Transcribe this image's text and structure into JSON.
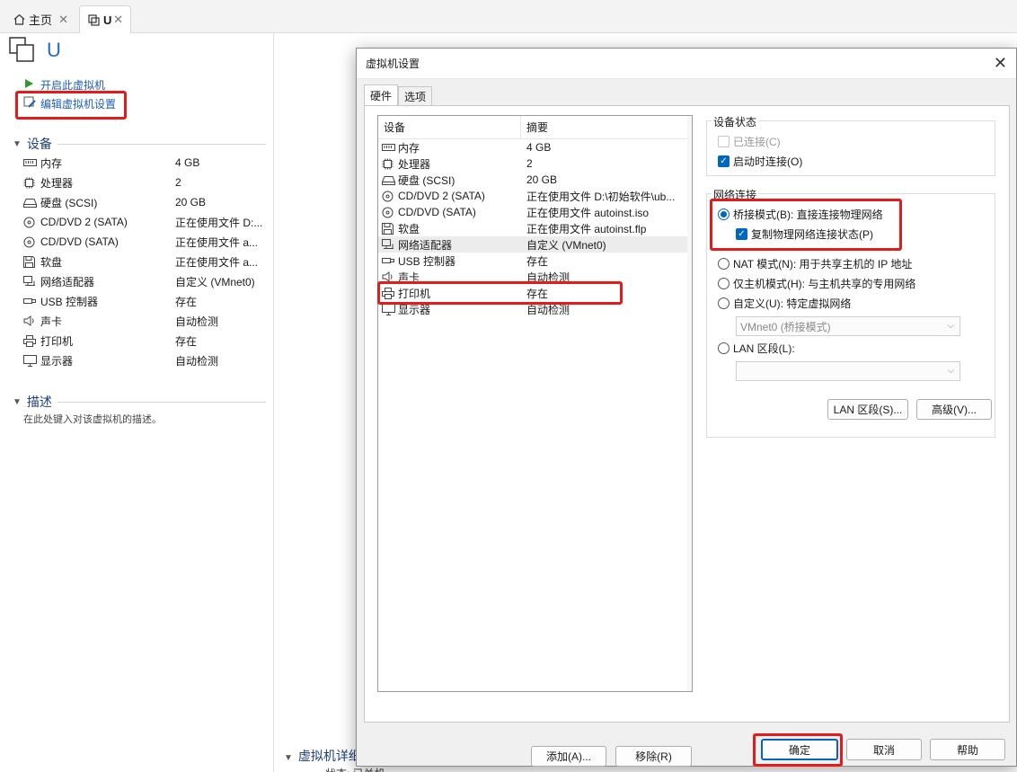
{
  "tabs": [
    {
      "label": "主页",
      "icon": "home-icon"
    },
    {
      "label": "U",
      "icon": "vm-icon"
    }
  ],
  "vm": {
    "name": "U",
    "actions": [
      {
        "label": "开启此虚拟机",
        "icon": "play-icon"
      },
      {
        "label": "编辑虚拟机设置",
        "icon": "edit-settings-icon"
      }
    ],
    "devices_heading": "设备",
    "devices": [
      {
        "name": "内存",
        "value": "4 GB",
        "icon": "memory-icon"
      },
      {
        "name": "处理器",
        "value": "2",
        "icon": "cpu-icon"
      },
      {
        "name": "硬盘 (SCSI)",
        "value": "20 GB",
        "icon": "harddisk-icon"
      },
      {
        "name": "CD/DVD 2 (SATA)",
        "value": "正在使用文件 D:...",
        "icon": "cdrom-icon"
      },
      {
        "name": "CD/DVD (SATA)",
        "value": "正在使用文件 a...",
        "icon": "cdrom-icon"
      },
      {
        "name": "软盘",
        "value": "正在使用文件 a...",
        "icon": "floppy-icon"
      },
      {
        "name": "网络适配器",
        "value": "自定义 (VMnet0)",
        "icon": "network-icon"
      },
      {
        "name": "USB 控制器",
        "value": "存在",
        "icon": "usb-icon"
      },
      {
        "name": "声卡",
        "value": "自动检测",
        "icon": "speaker-icon"
      },
      {
        "name": "打印机",
        "value": "存在",
        "icon": "printer-icon"
      },
      {
        "name": "显示器",
        "value": "自动检测",
        "icon": "monitor-icon"
      }
    ],
    "description_heading": "描述",
    "description_placeholder": "在此处键入对该虚拟机的描述。",
    "details_heading": "虚拟机详细",
    "details_status": "状态: 已关机"
  },
  "dialog": {
    "title": "虚拟机设置",
    "tabs": [
      "硬件",
      "选项"
    ],
    "list_headers": {
      "device": "设备",
      "summary": "摘要"
    },
    "hardware": [
      {
        "name": "内存",
        "summary": "4 GB",
        "icon": "memory-icon"
      },
      {
        "name": "处理器",
        "summary": "2",
        "icon": "cpu-icon"
      },
      {
        "name": "硬盘 (SCSI)",
        "summary": "20 GB",
        "icon": "harddisk-icon"
      },
      {
        "name": "CD/DVD 2 (SATA)",
        "summary": "正在使用文件 D:\\初始软件\\ub...",
        "icon": "cdrom-icon"
      },
      {
        "name": "CD/DVD (SATA)",
        "summary": "正在使用文件 autoinst.iso",
        "icon": "cdrom-icon"
      },
      {
        "name": "软盘",
        "summary": "正在使用文件 autoinst.flp",
        "icon": "floppy-icon"
      },
      {
        "name": "网络适配器",
        "summary": "自定义 (VMnet0)",
        "icon": "network-icon"
      },
      {
        "name": "USB 控制器",
        "summary": "存在",
        "icon": "usb-icon"
      },
      {
        "name": "声卡",
        "summary": "自动检测",
        "icon": "speaker-icon"
      },
      {
        "name": "打印机",
        "summary": "存在",
        "icon": "printer-icon"
      },
      {
        "name": "显示器",
        "summary": "自动检测",
        "icon": "monitor-icon"
      }
    ],
    "add_button": "添加(A)...",
    "remove_button": "移除(R)",
    "device_status": {
      "label": "设备状态",
      "connected": "已连接(C)",
      "connect_on_power": "启动时连接(O)"
    },
    "network": {
      "label": "网络连接",
      "bridged": "桥接模式(B): 直接连接物理网络",
      "replicate": "复制物理网络连接状态(P)",
      "nat": "NAT 模式(N): 用于共享主机的 IP 地址",
      "host_only": "仅主机模式(H): 与主机共享的专用网络",
      "custom": "自定义(U): 特定虚拟网络",
      "custom_select": "VMnet0 (桥接模式)",
      "lan": "LAN 区段(L):",
      "lan_select": ""
    },
    "lan_segments_button": "LAN 区段(S)...",
    "advanced_button": "高级(V)...",
    "ok_button": "确定",
    "cancel_button": "取消",
    "help_button": "帮助"
  },
  "colors": {
    "highlight": "#e31b1b",
    "accent": "#0067c0",
    "link": "#1d5fb8"
  }
}
